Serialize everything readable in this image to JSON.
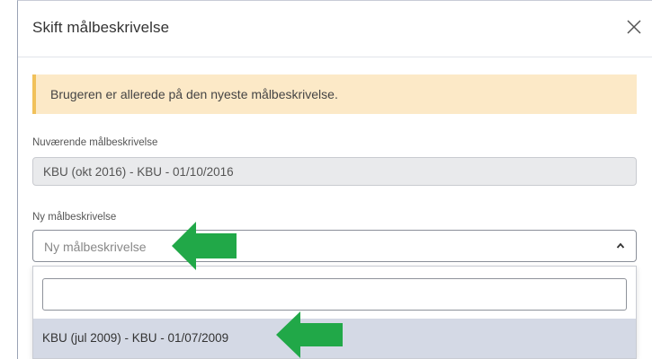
{
  "dialog": {
    "title": "Skift målbeskrivelse",
    "close_icon": "close-icon"
  },
  "alert": {
    "message": "Brugeren er allerede på den nyeste målbeskrivelse.",
    "color": "#fce9c7",
    "accent": "#f1c15a"
  },
  "current": {
    "label": "Nuværende målbeskrivelse",
    "value": "KBU (okt 2016) - KBU - 01/10/2016"
  },
  "new_select": {
    "label": "Ny målbeskrivelse",
    "placeholder": "Ny målbeskrivelse",
    "chevron_icon": "chevron-up-icon",
    "search_value": "",
    "options": [
      {
        "label": "KBU (jul 2009) - KBU - 01/07/2009",
        "highlighted": true
      }
    ]
  },
  "annotations": {
    "arrow_color": "#21a848",
    "arrow_icon": "arrow-left-icon"
  }
}
